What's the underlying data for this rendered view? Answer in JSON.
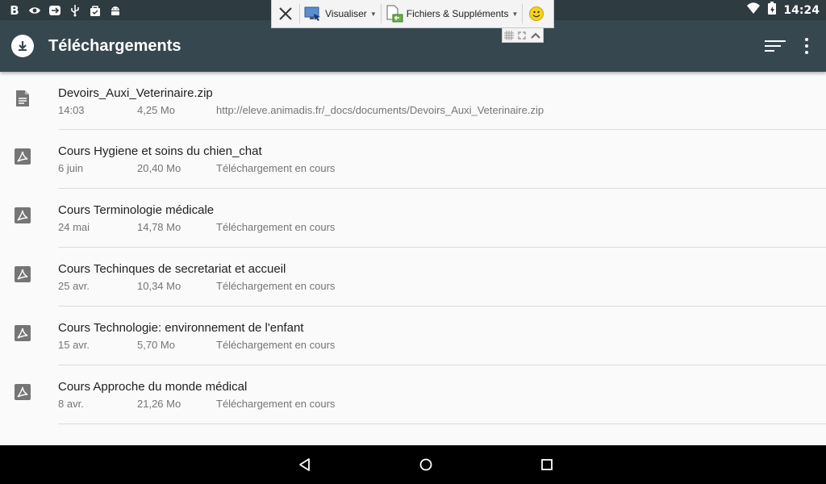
{
  "status_bar": {
    "time": "14:24",
    "left_icons": [
      "b-icon",
      "eye-icon",
      "router-icon",
      "usb-icon",
      "bag-icon",
      "android-icon"
    ],
    "right_icons": [
      "wifi-icon",
      "battery-icon"
    ]
  },
  "floating_toolbar": {
    "view_label": "Visualiser",
    "files_label": "Fichiers & Suppléments"
  },
  "app_bar": {
    "title": "Téléchargements",
    "color": "#37474f"
  },
  "downloads": [
    {
      "icon": "document-icon",
      "name": "Devoirs_Auxi_Veterinaire.zip",
      "date": "14:03",
      "size": "4,25 Mo",
      "status": "http://eleve.animadis.fr/_docs/documents/Devoirs_Auxi_Veterinaire.zip"
    },
    {
      "icon": "pdf-icon",
      "name": "Cours Hygiene et soins du chien_chat",
      "date": "6 juin",
      "size": "20,40 Mo",
      "status": "Téléchargement en cours"
    },
    {
      "icon": "pdf-icon",
      "name": "Cours Terminologie médicale",
      "date": "24 mai",
      "size": "14,78 Mo",
      "status": "Téléchargement en cours"
    },
    {
      "icon": "pdf-icon",
      "name": "Cours Techinques de secretariat et accueil",
      "date": "25 avr.",
      "size": "10,34 Mo",
      "status": "Téléchargement en cours"
    },
    {
      "icon": "pdf-icon",
      "name": "Cours Technologie: environnement de l'enfant",
      "date": "15 avr.",
      "size": "5,70 Mo",
      "status": "Téléchargement en cours"
    },
    {
      "icon": "pdf-icon",
      "name": "Cours Approche du monde médical",
      "date": "8 avr.",
      "size": "21,26 Mo",
      "status": "Téléchargement en cours"
    }
  ]
}
